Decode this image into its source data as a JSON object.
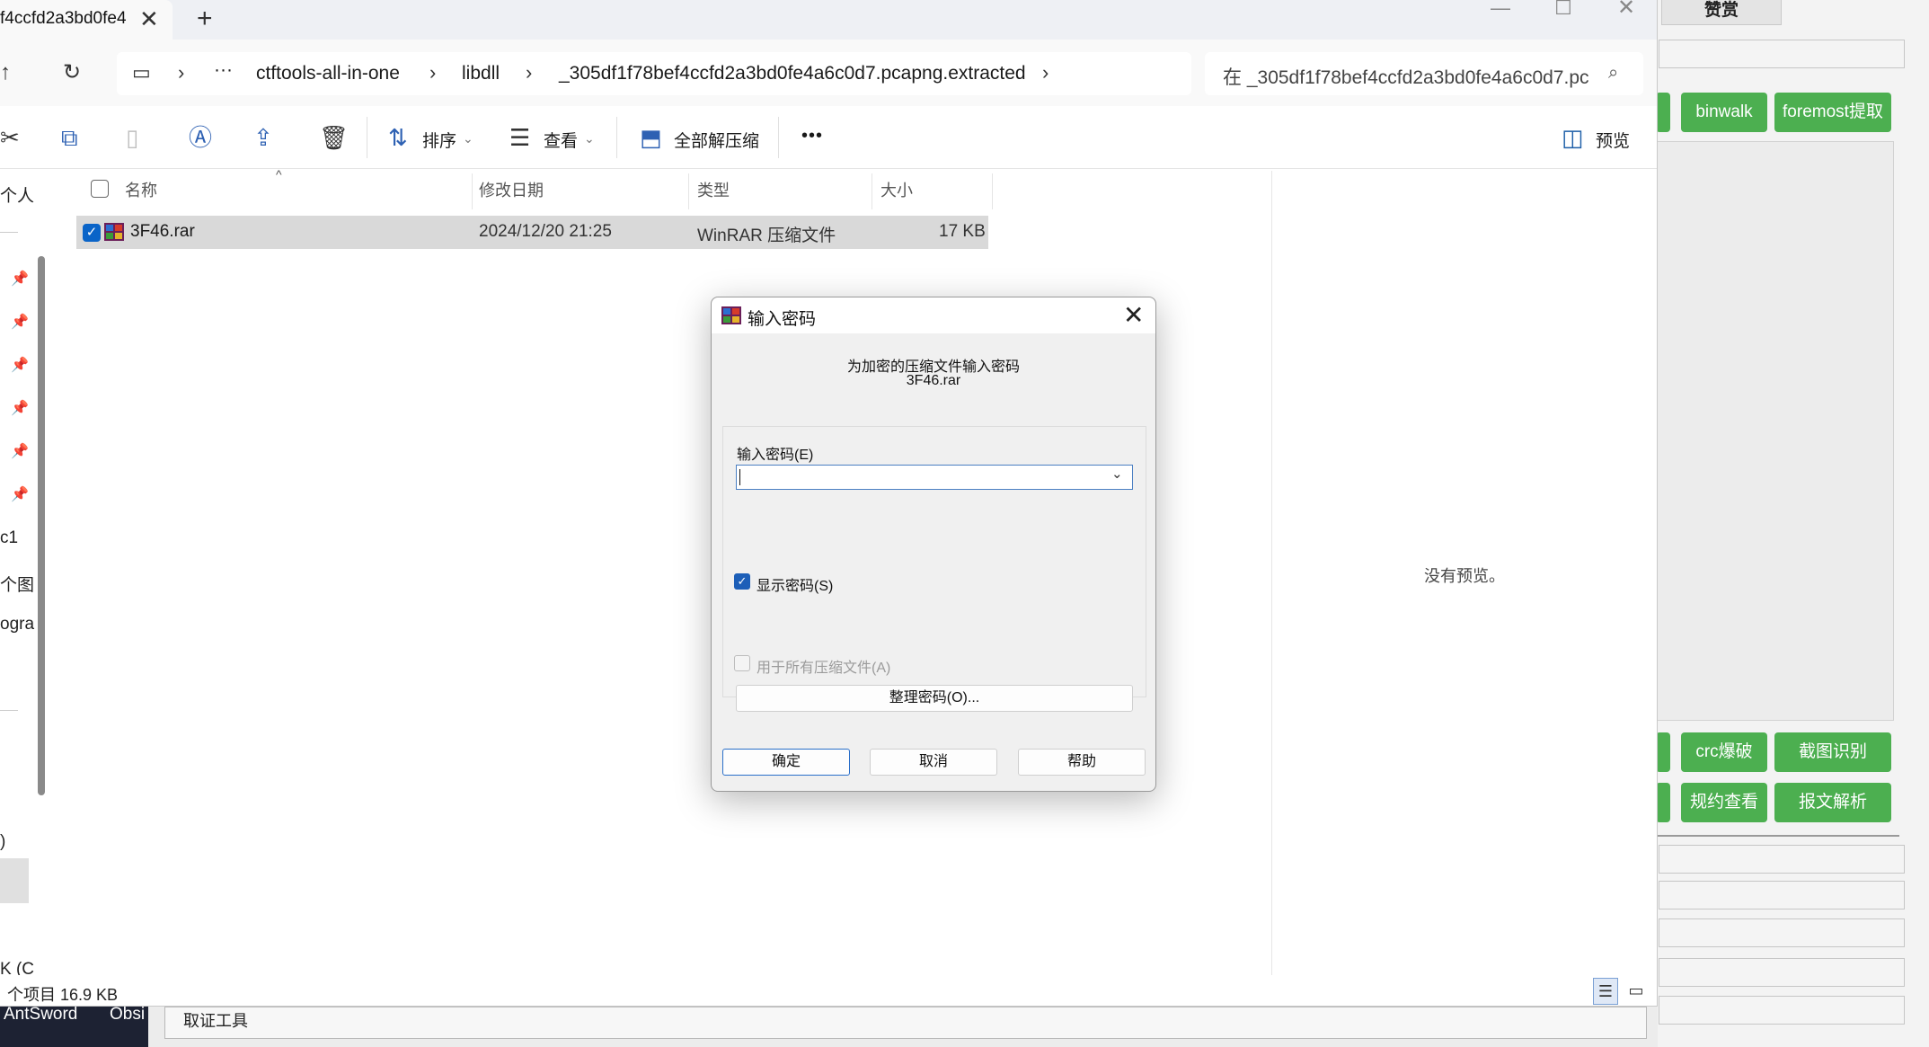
{
  "background_app": {
    "tab_label": "赞赏",
    "buttons": {
      "binwalk": "binwalk",
      "foremost": "foremost提取",
      "crc": "crc爆破",
      "screenshot_ocr": "截图识别",
      "rules": "规约查看",
      "packet_parse": "报文解析"
    },
    "accent_color": "#4caf50"
  },
  "taskbar": {
    "antsword": "AntSword",
    "obsidian": "Obsi",
    "bottom_field": "取证工具"
  },
  "explorer": {
    "tab_title": "f4ccfd2a3bd0fe4",
    "breadcrumbs": [
      "ctftools-all-in-one",
      "libdll",
      "_305df1f78bef4ccfd2a3bd0fe4a6c0d7.pcapng.extracted"
    ],
    "search_placeholder": "在 _305df1f78bef4ccfd2a3bd0fe4a6c0d7.pc",
    "toolbar": {
      "sort": "排序",
      "view": "查看",
      "extract_all": "全部解压缩",
      "more": "•••",
      "preview": "预览"
    },
    "columns": {
      "name": "名称",
      "modified": "修改日期",
      "type": "类型",
      "size": "大小"
    },
    "files": [
      {
        "name": "3F46.rar",
        "modified": "2024/12/20 21:25",
        "type": "WinRAR 压缩文件",
        "size": "17 KB"
      }
    ],
    "sidebar": {
      "items": [
        "个人",
        "c1",
        "个图",
        "ogra",
        ")",
        "K (C"
      ]
    },
    "preview_empty": "没有预览。",
    "status": "个项目  16.9 KB"
  },
  "dialog": {
    "title": "输入密码",
    "message_line1": "为加密的压缩文件输入密码",
    "message_line2": "3F46.rar",
    "password_label": "输入密码(E)",
    "password_value": "",
    "show_password": "显示密码(S)",
    "show_password_checked": true,
    "use_for_all": "用于所有压缩文件(A)",
    "organize": "整理密码(O)...",
    "ok": "确定",
    "cancel": "取消",
    "help": "帮助"
  }
}
